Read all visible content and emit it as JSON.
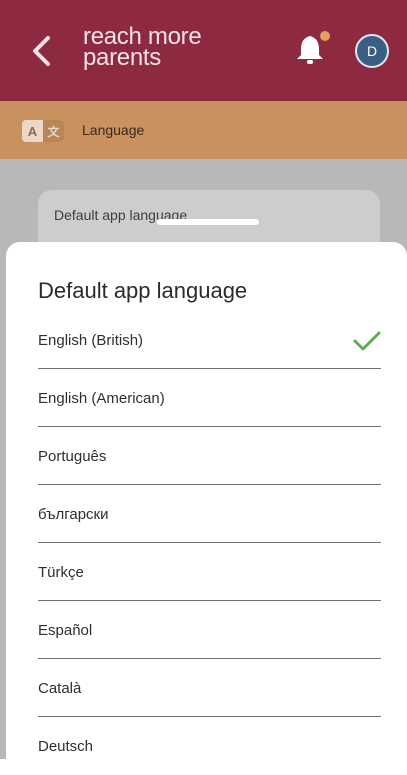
{
  "header": {
    "logo_line1": "reach more",
    "logo_line2": "parents",
    "avatar_initial": "D",
    "notification_dot_color": "#e0a066"
  },
  "section": {
    "title": "Language",
    "icon_text_a": "A",
    "icon_text_b": "文"
  },
  "background": {
    "card_label": "Default app language"
  },
  "sheet": {
    "title": "Default app language",
    "options": [
      {
        "label": "English (British)",
        "selected": true
      },
      {
        "label": "English (American)",
        "selected": false
      },
      {
        "label": "Português",
        "selected": false
      },
      {
        "label": "български",
        "selected": false
      },
      {
        "label": "Türkçe",
        "selected": false
      },
      {
        "label": "Español",
        "selected": false
      },
      {
        "label": "Català",
        "selected": false
      },
      {
        "label": "Deutsch",
        "selected": false
      }
    ]
  },
  "colors": {
    "header": "#8e2a40",
    "section_bar": "#c8915d",
    "check": "#5cae52"
  }
}
